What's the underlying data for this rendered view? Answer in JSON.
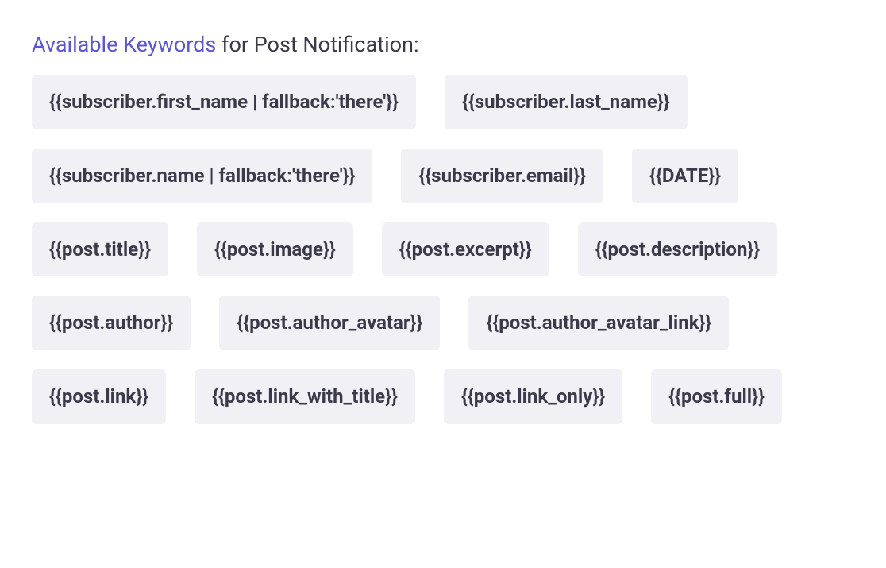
{
  "header": {
    "link": "Available Keywords",
    "rest": " for Post Notification:"
  },
  "keywords": [
    "{{subscriber.first_name | fallback:'there'}}",
    "{{subscriber.last_name}}",
    "{{subscriber.name | fallback:'there'}}",
    "{{subscriber.email}}",
    "{{DATE}}",
    "{{post.title}}",
    "{{post.image}}",
    "{{post.excerpt}}",
    "{{post.description}}",
    "{{post.author}}",
    "{{post.author_avatar}}",
    "{{post.author_avatar_link}}",
    "{{post.link}}",
    "{{post.link_with_title}}",
    "{{post.link_only}}",
    "{{post.full}}"
  ]
}
